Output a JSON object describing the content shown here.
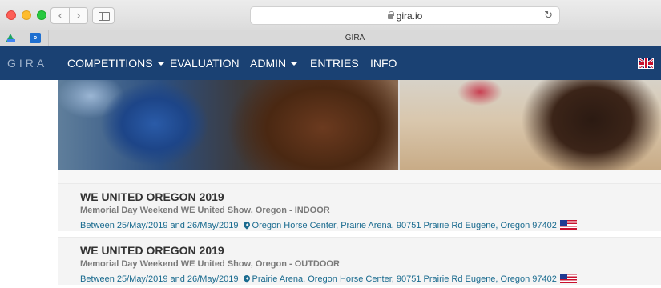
{
  "browser": {
    "url": "gira.io",
    "tab_title": "GIRA",
    "nav_back": "‹",
    "nav_forward": "›",
    "reload": "↻",
    "bookmarks": [
      {
        "name": "google-drive",
        "label": ""
      },
      {
        "name": "outlook",
        "label": "o"
      }
    ]
  },
  "navbar": {
    "brand": "GIRA",
    "items": [
      {
        "label": "COMPETITIONS",
        "dropdown": true
      },
      {
        "label": "EVALUATION",
        "dropdown": false
      },
      {
        "label": "ADMIN",
        "dropdown": true
      },
      {
        "label": "ENTRIES",
        "dropdown": false
      },
      {
        "label": "INFO",
        "dropdown": false
      }
    ],
    "language_flag": "uk-flag-icon"
  },
  "competitions": [
    {
      "title": "WE UNITED OREGON 2019",
      "subtitle": "Memorial Day Weekend WE United Show, Oregon - INDOOR",
      "dates": "Between 25/May/2019 and 26/May/2019",
      "location": "Oregon Horse Center, Prairie Arena, 90751 Prairie Rd Eugene, Oregon 97402",
      "flag": "us-flag-icon"
    },
    {
      "title": "WE UNITED OREGON 2019",
      "subtitle": "Memorial Day Weekend WE United Show, Oregon - OUTDOOR",
      "dates": "Between 25/May/2019 and 26/May/2019",
      "location": "Prairie Arena, Oregon Horse Center, 90751 Prairie Rd Eugene, Oregon 97402",
      "flag": "us-flag-icon"
    }
  ],
  "colors": {
    "navbar": "#1a4173",
    "link": "#1a6b8f",
    "title": "#333333",
    "subtitle": "#7a7a7a"
  }
}
